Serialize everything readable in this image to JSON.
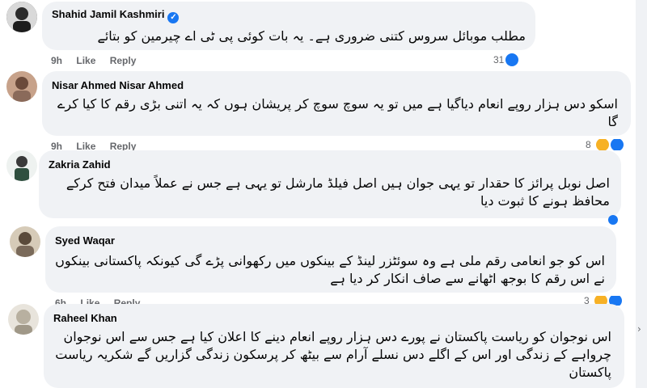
{
  "comments": [
    {
      "name": "Shahid Jamil Kashmiri",
      "verified": true,
      "text": "مطلب موبائل سروس کتنی ضروری ہے۔ یہ بات کوئی پی ٹی اے چیرمین کو بتائے",
      "time": "9h",
      "like": "Like",
      "reply": "Reply",
      "reactions": "31"
    },
    {
      "name": "Nisar Ahmed Nisar Ahmed",
      "text": "اسکو دس ہزار روپے انعام دیاگیا ہے میں تو یہ سوچ سوچ کر پریشان ہوں کہ یہ اتنی بڑی رقم کا کیا کرے گا",
      "time": "9h",
      "like": "Like",
      "reply": "Reply",
      "reactions": "8"
    },
    {
      "name": "Zakria Zahid",
      "text": "اصل نوبل پرائز کا حقدار تو یہی جوان ہیں اصل فیلڈ مارشل تو یہی ہے جس نے عملاً میدان فتح کرکے محافظ ہونے کا ثبوت دیا"
    },
    {
      "name": "Syed Waqar",
      "text": "اس کو جو انعامی رقم ملی ہے وہ سوئٹزر لینڈ کے بینکوں میں رکھوانی پڑے گی کیونکہ پاکستانی بینکوں نے اس رقم کا بوجھ اٹھانے سے صاف انکار کر دیا ہے",
      "time": "6h",
      "like": "Like",
      "reply": "Reply",
      "reactions": "3"
    },
    {
      "name": "Raheel Khan",
      "text": "اس نوجوان کو ریاست پاکستان نے پورے دس ہزار روپے انعام دینے کا اعلان کیا ہے جس سے اس نوجوان چرواہے کے زندگی اور اس کے اگلے دس نسلے آرام سے بیٹھ کر پرسکون زندگی گزاریں گے شکریہ ریاست پاکستان"
    }
  ],
  "colors": {
    "bubble": "#f0f2f5",
    "meta": "#65676b",
    "like": "#1877f2",
    "haha": "#f7b125"
  }
}
